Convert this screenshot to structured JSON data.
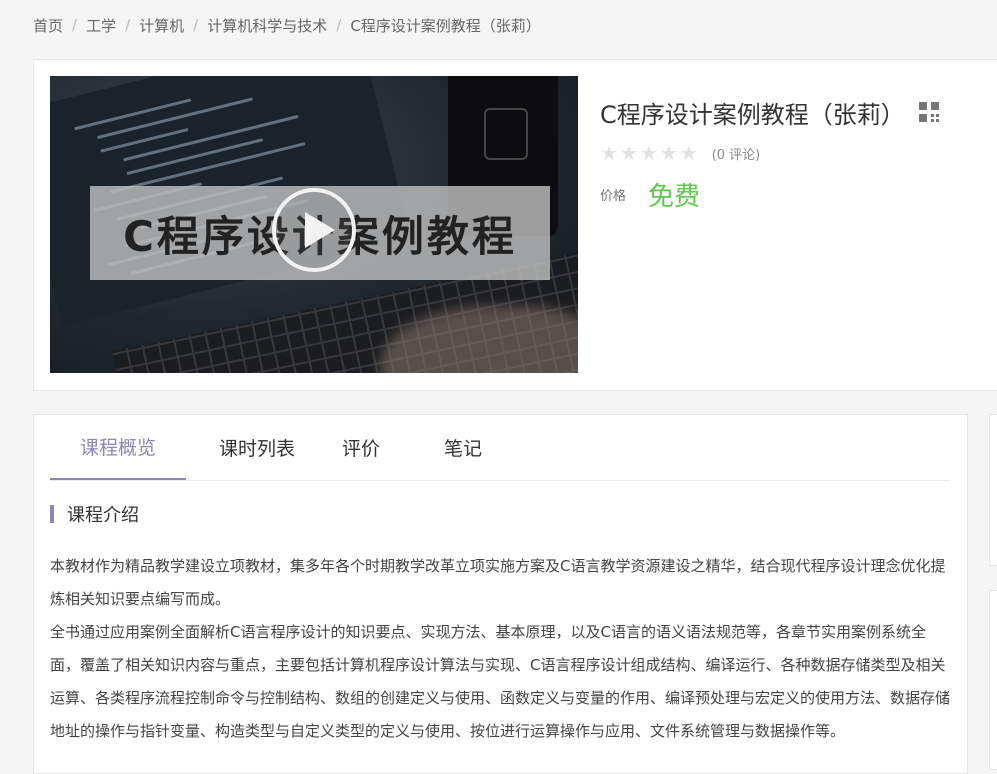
{
  "breadcrumb": [
    {
      "label": "首页"
    },
    {
      "label": "工学"
    },
    {
      "label": "计算机"
    },
    {
      "label": "计算机科学与技术"
    },
    {
      "label": "C程序设计案例教程（张莉）"
    }
  ],
  "breadcrumb_separator": "/",
  "course": {
    "title": "C程序设计案例教程（张莉）",
    "video_banner_text": "C程序设计案例教程",
    "rating": 0,
    "rating_max": 5,
    "reviews_text": "(0 评论)",
    "price_label": "价格",
    "price_value": "免费"
  },
  "tabs": [
    {
      "label": "课程概览",
      "active": true
    },
    {
      "label": "课时列表",
      "active": false
    },
    {
      "label": "评价",
      "active": false
    },
    {
      "label": "笔记",
      "active": false
    }
  ],
  "section": {
    "heading": "课程介绍",
    "paragraphs": [
      "本教材作为精品教学建设立项教材，集多年各个时期教学改革立项实施方案及C语言教学资源建设之精华，结合现代程序设计理念优化提炼相关知识要点编写而成。",
      "全书通过应用案例全面解析C语言程序设计的知识要点、实现方法、基本原理，以及C语言的语义语法规范等，各章节实用案例系统全面，覆盖了相关知识内容与重点，主要包括计算机程序设计算法与实现、C语言程序设计组成结构、编译运行、各种数据存储类型及相关运算、各类程序流程控制命令与控制结构、数组的创建定义与使用、函数定义与变量的作用、编译预处理与宏定义的使用方法、数据存储地址的操作与指针变量、构造类型与自定义类型的定义与使用、按位进行运算操作与应用、文件系统管理与数据操作等。"
    ]
  },
  "colors": {
    "accent": "#8e86b5",
    "price": "#5cc94b",
    "star_empty": "#e2e2e2"
  }
}
